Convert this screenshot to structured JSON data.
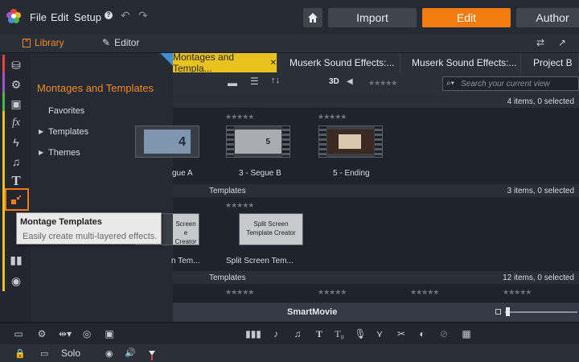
{
  "menu": {
    "file": "File",
    "edit": "Edit",
    "setup": "Setup"
  },
  "nav": {
    "import": "Import",
    "edit": "Edit",
    "author": "Author"
  },
  "modeTabs": {
    "library": "Library",
    "editor": "Editor"
  },
  "flyout": {
    "title": "Montages and Templates",
    "items": [
      "Favorites",
      "Templates",
      "Themes"
    ]
  },
  "contentTabs": [
    "Montages and Templa...",
    "Muserk Sound Effects:...",
    "Muserk Sound Effects:...",
    "Project B"
  ],
  "toolbar": {
    "label3d": "3D",
    "searchPlaceholder": "Search your current view"
  },
  "sections": {
    "first": {
      "count": "4 items, 0 selected"
    },
    "second": {
      "title": "Templates",
      "count": "3 items, 0 selected"
    },
    "third": {
      "title": "Templates",
      "count": "12 items, 0 selected"
    }
  },
  "row1": [
    {
      "label": "gue A",
      "text": "4"
    },
    {
      "label": "3 - Segue B",
      "text": "5"
    },
    {
      "label": "5 - Ending",
      "text": ""
    }
  ],
  "row2": [
    {
      "label": "n Tem...",
      "line1": "Screen",
      "line2": "e Creator"
    },
    {
      "label": "Split Screen Tem...",
      "line1": "Split Screen",
      "line2": "Template Creator"
    }
  ],
  "smartmovie": "SmartMovie",
  "track": {
    "solo": "Solo"
  },
  "tooltip": {
    "title": "Montage Templates",
    "desc": "Easily create multi-layered effects."
  },
  "stars": "★★★★★",
  "colors": {
    "accent": "#f47b10",
    "activeTab": "#e9c21d",
    "flyoutTitle": "#f28a1e"
  }
}
